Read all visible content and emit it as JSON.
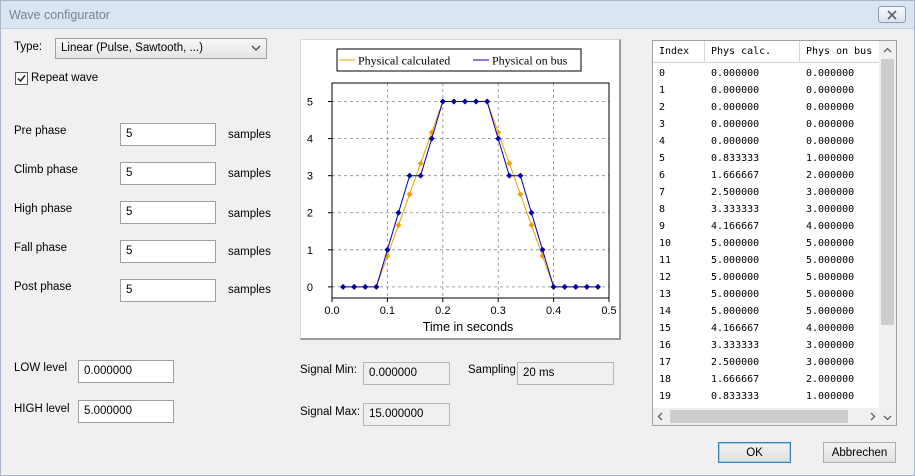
{
  "window": {
    "title": "Wave configurator"
  },
  "type": {
    "label": "Type:",
    "value": "Linear (Pulse, Sawtooth, ...)"
  },
  "repeat": {
    "label": "Repeat wave",
    "checked": true
  },
  "phases": [
    {
      "label": "Pre phase",
      "value": "5",
      "unit": "samples"
    },
    {
      "label": "Climb phase",
      "value": "5",
      "unit": "samples"
    },
    {
      "label": "High phase",
      "value": "5",
      "unit": "samples"
    },
    {
      "label": "Fall phase",
      "value": "5",
      "unit": "samples"
    },
    {
      "label": "Post phase",
      "value": "5",
      "unit": "samples"
    }
  ],
  "levels": {
    "low": {
      "label": "LOW level",
      "value": "0.000000"
    },
    "high": {
      "label": "HIGH level",
      "value": "5.000000"
    }
  },
  "signal": {
    "min_label": "Signal Min:",
    "min_value": "0.000000",
    "max_label": "Signal Max:",
    "max_value": "15.000000",
    "sampling_label": "Sampling:",
    "sampling_value": "20 ms"
  },
  "chart_data": {
    "type": "line",
    "xlabel": "Time in seconds",
    "ylabel": "",
    "xlim": [
      0,
      0.5
    ],
    "ylim": [
      -0.3,
      5.5
    ],
    "xticks": [
      "0.0",
      "0.1",
      "0.2",
      "0.3",
      "0.4",
      "0.5"
    ],
    "yticks": [
      "0",
      "1",
      "2",
      "3",
      "4",
      "5"
    ],
    "grid": true,
    "legend": "top",
    "series": [
      {
        "name": "Physical calculated",
        "color": "#f0a000",
        "x": [
          0.02,
          0.04,
          0.06,
          0.08,
          0.1,
          0.12,
          0.14,
          0.16,
          0.18,
          0.2,
          0.22,
          0.24,
          0.26,
          0.28,
          0.3,
          0.32,
          0.34,
          0.36,
          0.38,
          0.4,
          0.42,
          0.44,
          0.46,
          0.48
        ],
        "y": [
          0,
          0,
          0,
          0,
          0.833333,
          1.666667,
          2.5,
          3.333333,
          4.166667,
          5,
          5,
          5,
          5,
          5,
          4.166667,
          3.333333,
          2.5,
          1.666667,
          0.833333,
          0,
          0,
          0,
          0,
          0
        ]
      },
      {
        "name": "Physical on bus",
        "color": "#0000b0",
        "x": [
          0.02,
          0.04,
          0.06,
          0.08,
          0.1,
          0.12,
          0.14,
          0.16,
          0.18,
          0.2,
          0.22,
          0.24,
          0.26,
          0.28,
          0.3,
          0.32,
          0.34,
          0.36,
          0.38,
          0.4,
          0.42,
          0.44,
          0.46,
          0.48
        ],
        "y": [
          0,
          0,
          0,
          0,
          1,
          2,
          3,
          3,
          4,
          5,
          5,
          5,
          5,
          5,
          4,
          3,
          3,
          2,
          1,
          0,
          0,
          0,
          0,
          0
        ]
      }
    ]
  },
  "table": {
    "columns": [
      "Index",
      "Phys calc.",
      "Phys on bus"
    ],
    "rows": [
      [
        "0",
        "0.000000",
        "0.000000"
      ],
      [
        "1",
        "0.000000",
        "0.000000"
      ],
      [
        "2",
        "0.000000",
        "0.000000"
      ],
      [
        "3",
        "0.000000",
        "0.000000"
      ],
      [
        "4",
        "0.000000",
        "0.000000"
      ],
      [
        "5",
        "0.833333",
        "1.000000"
      ],
      [
        "6",
        "1.666667",
        "2.000000"
      ],
      [
        "7",
        "2.500000",
        "3.000000"
      ],
      [
        "8",
        "3.333333",
        "3.000000"
      ],
      [
        "9",
        "4.166667",
        "4.000000"
      ],
      [
        "10",
        "5.000000",
        "5.000000"
      ],
      [
        "11",
        "5.000000",
        "5.000000"
      ],
      [
        "12",
        "5.000000",
        "5.000000"
      ],
      [
        "13",
        "5.000000",
        "5.000000"
      ],
      [
        "14",
        "5.000000",
        "5.000000"
      ],
      [
        "15",
        "4.166667",
        "4.000000"
      ],
      [
        "16",
        "3.333333",
        "3.000000"
      ],
      [
        "17",
        "2.500000",
        "3.000000"
      ],
      [
        "18",
        "1.666667",
        "2.000000"
      ],
      [
        "19",
        "0.833333",
        "1.000000"
      ]
    ]
  },
  "buttons": {
    "ok": "OK",
    "cancel": "Abbrechen"
  }
}
